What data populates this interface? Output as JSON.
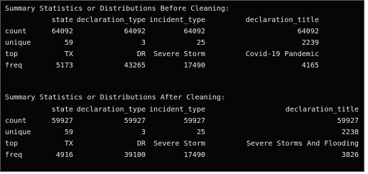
{
  "before": {
    "heading": "Summary Statistics or Distributions Before Cleaning:",
    "columns": [
      "state",
      "declaration_type",
      "incident_type",
      "declaration_title"
    ],
    "rows": [
      {
        "label": "count",
        "values": [
          "64092",
          "64092",
          "64092",
          "64092"
        ]
      },
      {
        "label": "unique",
        "values": [
          "59",
          "3",
          "25",
          "2239"
        ]
      },
      {
        "label": "top",
        "values": [
          "TX",
          "DR",
          "Severe Storm",
          "Covid-19 Pandemic"
        ]
      },
      {
        "label": "freq",
        "values": [
          "5173",
          "43265",
          "17490",
          "4165"
        ]
      }
    ]
  },
  "after": {
    "heading": "Summary Statistics or Distributions After Cleaning:",
    "columns": [
      "state",
      "declaration_type",
      "incident_type",
      "declaration_title"
    ],
    "rows": [
      {
        "label": "count",
        "values": [
          "59927",
          "59927",
          "59927",
          "59927"
        ]
      },
      {
        "label": "unique",
        "values": [
          "59",
          "3",
          "25",
          "2238"
        ]
      },
      {
        "label": "top",
        "values": [
          "TX",
          "DR",
          "Severe Storm",
          "Severe Storms And Flooding"
        ]
      },
      {
        "label": "freq",
        "values": [
          "4916",
          "39100",
          "17490",
          "3826"
        ]
      }
    ]
  }
}
